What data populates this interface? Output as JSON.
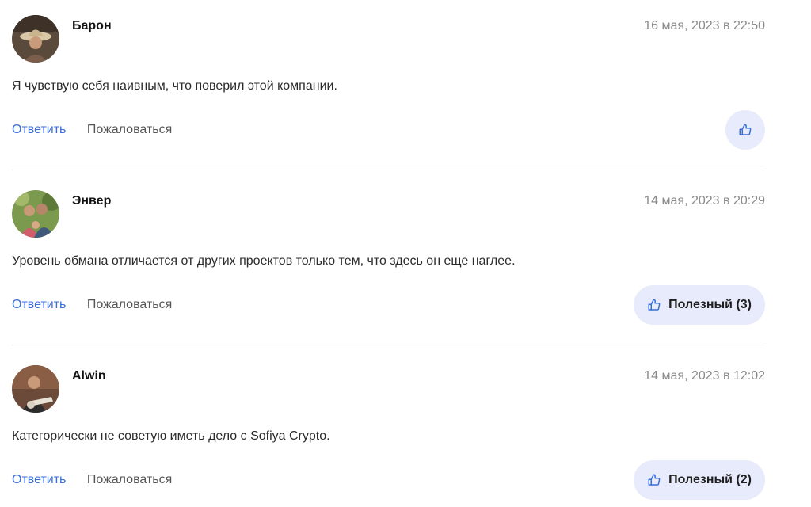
{
  "comments": [
    {
      "author": "Барон",
      "date": "16 мая, 2023 в 22:50",
      "text": "Я чувствую себя наивным, что поверил этой компании.",
      "reply_label": "Ответить",
      "report_label": "Пожаловаться",
      "useful_label": ""
    },
    {
      "author": "Энвер",
      "date": "14 мая, 2023 в 20:29",
      "text": "Уровень обмана отличается от других проектов только тем, что здесь он еще наглее.",
      "reply_label": "Ответить",
      "report_label": "Пожаловаться",
      "useful_label": "Полезный (3)"
    },
    {
      "author": "Alwin",
      "date": "14 мая, 2023 в 12:02",
      "text": "Категорически не советую иметь дело с Sofiya Crypto.",
      "reply_label": "Ответить",
      "report_label": "Пожаловаться",
      "useful_label": "Полезный (2)"
    }
  ],
  "colors": {
    "link": "#3b6fd8",
    "useful_bg": "#e7ebfb",
    "date": "#8a8a8a",
    "divider": "#e6e6e6"
  },
  "icons": {
    "useful": "thumbs-up-icon"
  }
}
